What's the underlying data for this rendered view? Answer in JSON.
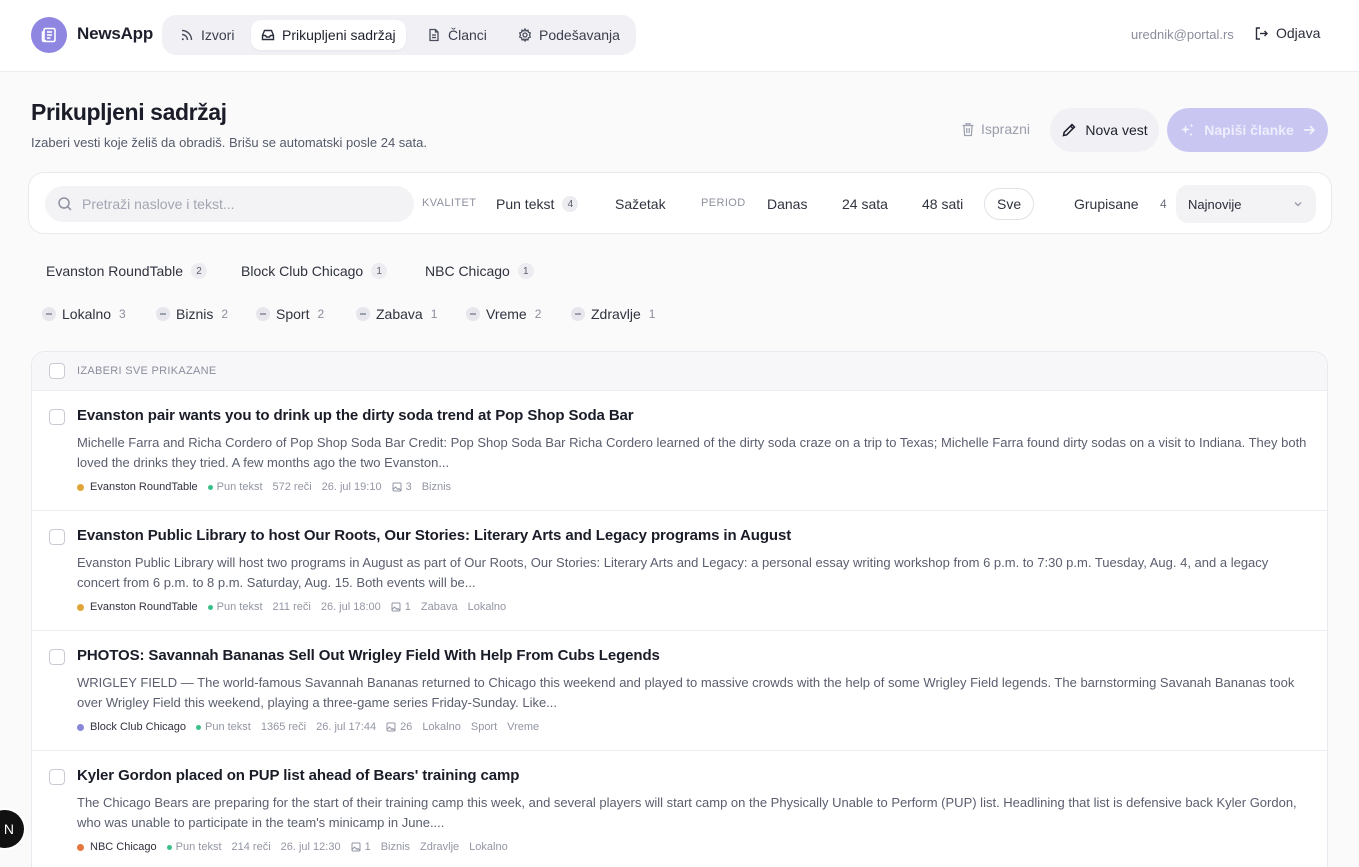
{
  "app": {
    "name": "NewsApp"
  },
  "nav": [
    {
      "label": "Izvori",
      "icon": "rss-icon"
    },
    {
      "label": "Prikupljeni sadržaj",
      "icon": "inbox-icon",
      "active": true
    },
    {
      "label": "Članci",
      "icon": "document-icon"
    },
    {
      "label": "Podešavanja",
      "icon": "gear-icon"
    }
  ],
  "user": {
    "email": "urednik@portal.rs",
    "logout_label": "Odjava"
  },
  "page": {
    "title": "Prikupljeni sadržaj",
    "subtitle": "Izaberi vesti koje želiš da obradiš. Brišu se automatski posle 24 sata."
  },
  "actions": {
    "clear_label": "Isprazni",
    "new_label": "Nova vest",
    "write_label": "Napiši članke"
  },
  "filters": {
    "search_placeholder": "Pretraži naslove i tekst...",
    "quality_label": "KVALITET",
    "full_text_label": "Pun tekst",
    "full_text_count": "4",
    "summary_label": "Sažetak",
    "period_label": "PERIOD",
    "period_today": "Danas",
    "period_24": "24 sata",
    "period_48": "48 sati",
    "period_all": "Sve",
    "grouped_label": "Grupisane",
    "grouped_count": "4",
    "sort_value": "Najnovije"
  },
  "sources": [
    {
      "name": "Evanston RoundTable",
      "count": "2"
    },
    {
      "name": "Block Club Chicago",
      "count": "1"
    },
    {
      "name": "NBC Chicago",
      "count": "1"
    }
  ],
  "categories": [
    {
      "name": "Lokalno",
      "count": "3"
    },
    {
      "name": "Biznis",
      "count": "2"
    },
    {
      "name": "Sport",
      "count": "2"
    },
    {
      "name": "Zabava",
      "count": "1"
    },
    {
      "name": "Vreme",
      "count": "2"
    },
    {
      "name": "Zdravlje",
      "count": "1"
    }
  ],
  "list": {
    "select_all_label": "IZABERI SVE PRIKAZANE",
    "items": [
      {
        "title": "Evanston pair wants you to drink up the dirty soda trend at Pop Shop Soda Bar",
        "body": "Michelle Farra and Richa Cordero of Pop Shop Soda Bar Credit: Pop Shop Soda Bar Richa Cordero learned of the dirty soda craze on a trip to Texas; Michelle Farra found dirty sodas on a visit to Indiana. They both loved the drinks they tried. A few months ago the two Evanston...",
        "source": "Evanston RoundTable",
        "source_color": "#e0a63a",
        "quality": "Pun tekst",
        "words": "572 reči",
        "date": "26. jul 19:10",
        "images": "3",
        "tags": [
          "Biznis"
        ]
      },
      {
        "title": "Evanston Public Library to host Our Roots, Our Stories: Literary Arts and Legacy programs in August",
        "body": "Evanston Public Library will host two programs in August as part of Our Roots, Our Stories: Literary Arts and Legacy: a personal essay writing workshop from 6 p.m. to 7:30 p.m. Tuesday, Aug. 4, and a legacy concert from 6 p.m. to 8 p.m. Saturday, Aug. 15. Both events will be...",
        "source": "Evanston RoundTable",
        "source_color": "#e0a63a",
        "quality": "Pun tekst",
        "words": "211 reči",
        "date": "26. jul 18:00",
        "images": "1",
        "tags": [
          "Zabava",
          "Lokalno"
        ]
      },
      {
        "title": "PHOTOS: Savannah Bananas Sell Out Wrigley Field With Help From Cubs Legends",
        "body": "WRIGLEY FIELD — The world-famous Savannah Bananas returned to Chicago this weekend and played to massive crowds with the help of some Wrigley Field legends. The barnstorming Savanah Bananas took over Wrigley Field this weekend, playing a three-game series Friday-Sunday. Like...",
        "source": "Block Club Chicago",
        "source_color": "#8a86d8",
        "quality": "Pun tekst",
        "words": "1365 reči",
        "date": "26. jul 17:44",
        "images": "26",
        "tags": [
          "Lokalno",
          "Sport",
          "Vreme"
        ]
      },
      {
        "title": "Kyler Gordon placed on PUP list ahead of Bears' training camp",
        "body": "The Chicago Bears are preparing for the start of their training camp this week, and several players will start camp on the Physically Unable to Perform (PUP) list. Headlining that list is defensive back Kyler Gordon, who was unable to participate in the team's minicamp in June....",
        "source": "NBC Chicago",
        "source_color": "#e5773e",
        "quality": "Pun tekst",
        "words": "214 reči",
        "date": "26. jul 12:30",
        "images": "1",
        "tags": [
          "Biznis",
          "Zdravlje",
          "Lokalno"
        ]
      }
    ]
  },
  "corner_badge": {
    "letter": "N"
  }
}
